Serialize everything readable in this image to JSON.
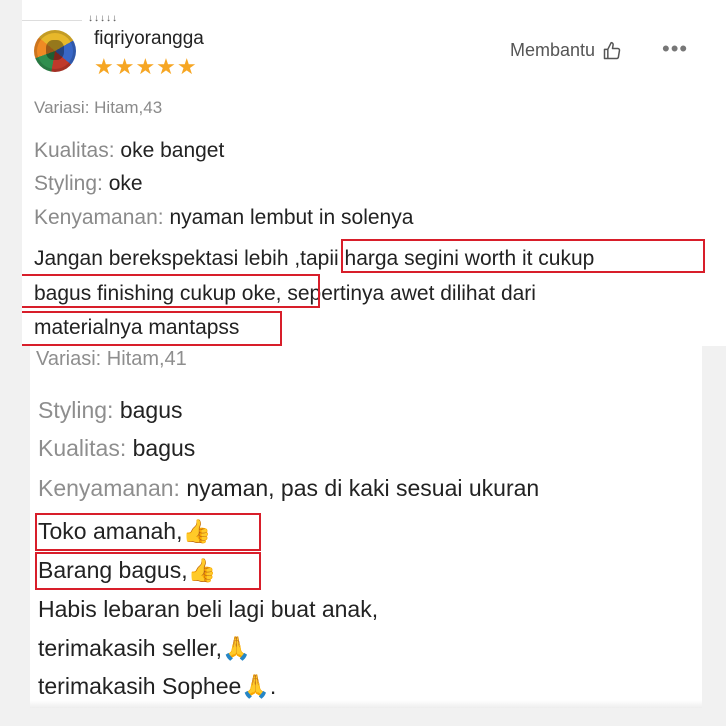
{
  "review_1": {
    "top_edge_text": "↓↓↓↓↓",
    "username": "fiqriyorangga",
    "rating_stars": "★★★★★",
    "helpful_label": "Membantu",
    "more_label": "•••",
    "variation": "Variasi: Hitam,43",
    "quality_label": "Kualitas:",
    "quality_value": "oke banget",
    "styling_label": "Styling:",
    "styling_value": "oke",
    "comfort_label": "Kenyamanan:",
    "comfort_value": "nyaman lembut in solenya",
    "comment_line_1": "Jangan berekspektasi lebih ,tapii harga segini worth it cukup",
    "comment_line_2": "bagus finishing cukup oke, sepertinya awet dilihat dari",
    "comment_line_3": "materialnya mantapss"
  },
  "review_2": {
    "variation": "Variasi: Hitam,41",
    "styling_label": "Styling:",
    "styling_value": "bagus",
    "quality_label": "Kualitas:",
    "quality_value": "bagus",
    "comfort_label": "Kenyamanan:",
    "comfort_value": "nyaman, pas di kaki sesuai ukuran",
    "comment_line_1": "Toko amanah,👍",
    "comment_line_2": "Barang bagus,👍",
    "comment_line_3": "Habis lebaran beli lagi buat anak,",
    "comment_line_4": "terimakasih seller,🙏",
    "comment_line_5": "terimakasih Sophee🙏."
  },
  "colors": {
    "highlight_border": "#d81e2a",
    "star": "#f6a623",
    "label_gray": "#8a8a8a"
  },
  "icons": [
    "avatar",
    "star-icon",
    "thumbs-up-icon",
    "more-icon"
  ]
}
